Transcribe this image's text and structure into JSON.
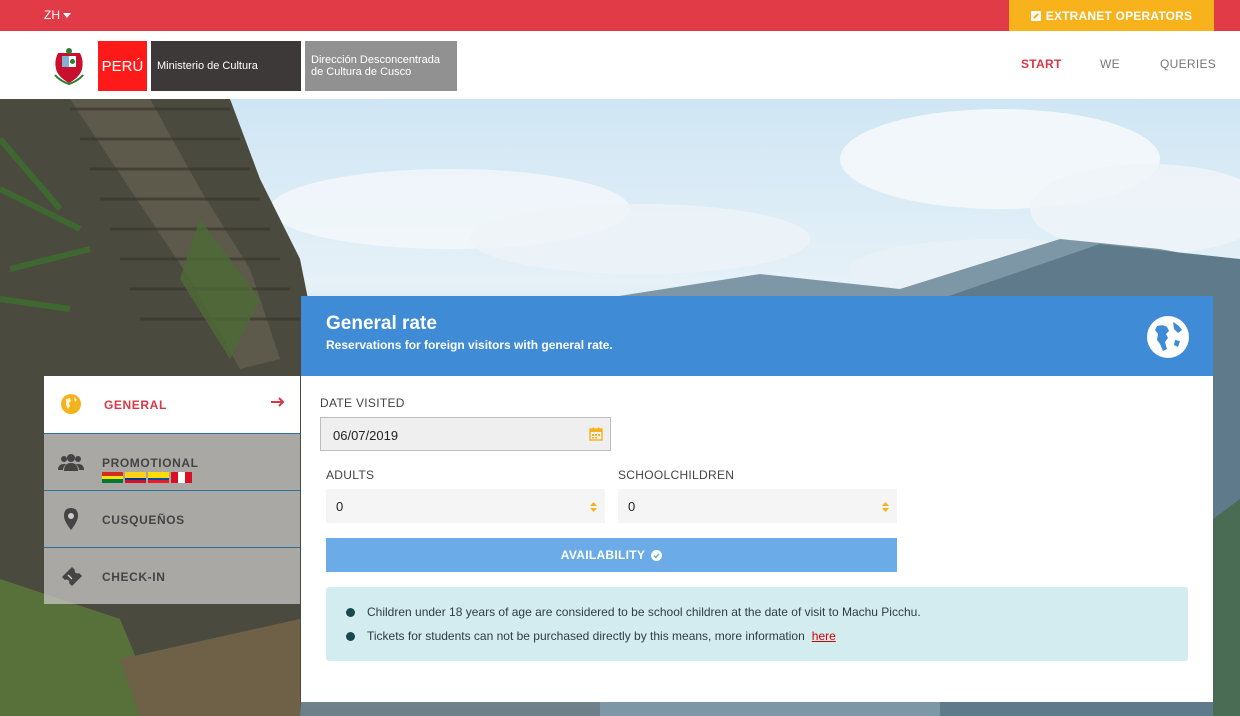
{
  "topbar": {
    "language": "ZH",
    "extranet_label": "EXTRANET OPERATORS",
    "bg_color": "#e13b48",
    "accent_color": "#f8b31c"
  },
  "header": {
    "peru_label": "PERÚ",
    "ministerio_label": "Ministerio de Cultura",
    "direccion_line1": "Dirección Desconcentrada",
    "direccion_line2": "de Cultura de Cusco",
    "nav": [
      {
        "label": "START",
        "active": true
      },
      {
        "label": "WE",
        "active": false
      },
      {
        "label": "QUERIES",
        "active": false
      }
    ]
  },
  "tabs": [
    {
      "label": "GENERAL",
      "icon": "globe-icon",
      "active": true
    },
    {
      "label": "PROMOTIONAL",
      "icon": "users-icon",
      "active": false
    },
    {
      "label": "CUSQUEÑOS",
      "icon": "map-pin-icon",
      "active": false
    },
    {
      "label": "CHECK-IN",
      "icon": "ticket-icon",
      "active": false
    }
  ],
  "panel": {
    "title": "General rate",
    "subtitle": "Reservations for foreign visitors with general rate.",
    "header_color": "#3f8bd6"
  },
  "form": {
    "date_label": "DATE VISITED",
    "date_value": "06/07/2019",
    "adults_label": "ADULTS",
    "adults_value": "0",
    "school_label": "SCHOOLCHILDREN",
    "school_value": "0",
    "availability_label": "AVAILABILITY"
  },
  "info": {
    "line1": "Children under 18 years of age are considered to be school children at the date of visit to Machu Picchu.",
    "line2": "Tickets for students can not be purchased directly by this means, more information",
    "link_label": "here"
  }
}
